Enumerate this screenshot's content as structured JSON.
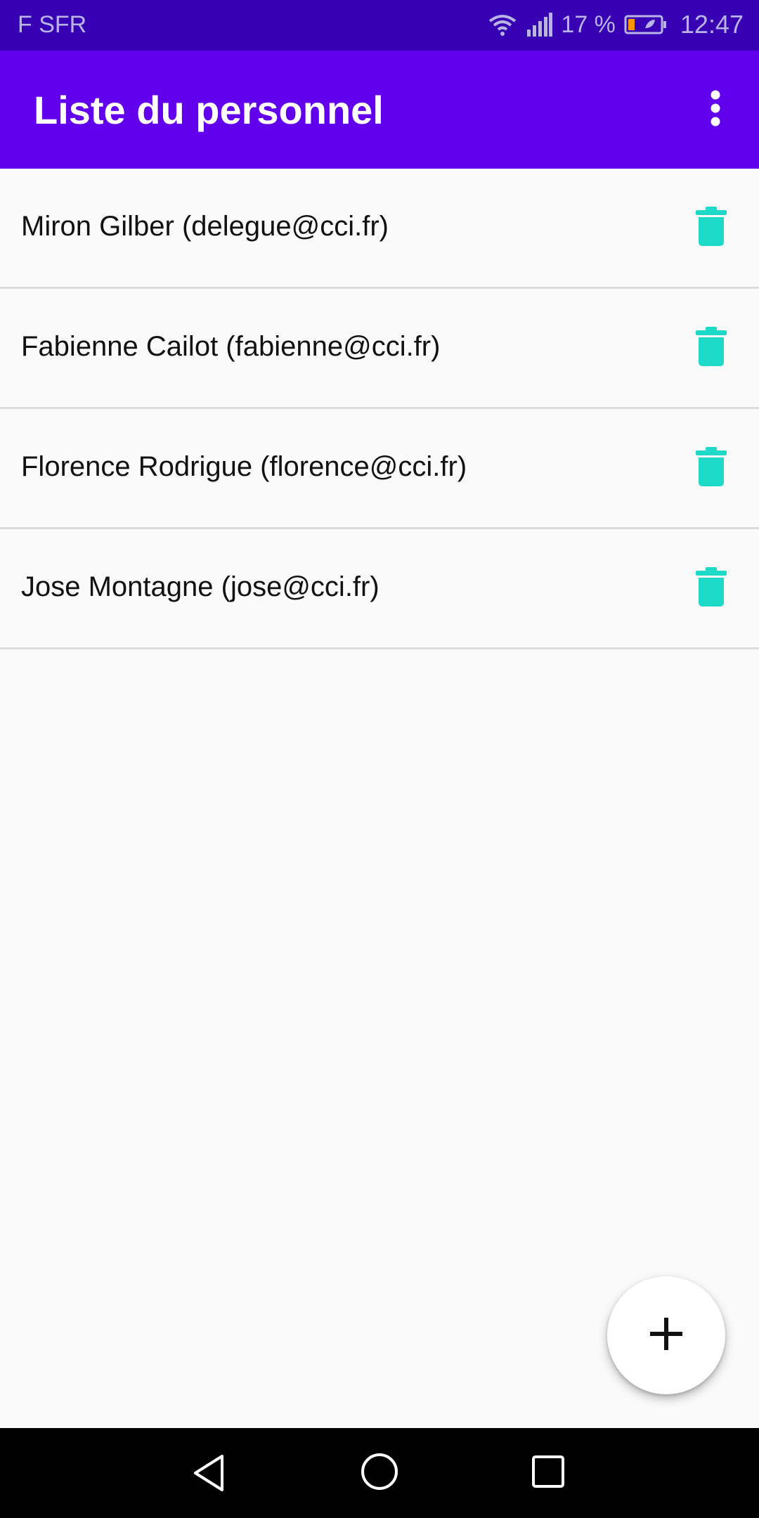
{
  "status_bar": {
    "carrier": "F SFR",
    "battery_percent": "17 %",
    "time": "12:47",
    "icons": [
      "wifi-icon",
      "signal-icon",
      "battery-icon"
    ]
  },
  "app_bar": {
    "title": "Liste du personnel",
    "overflow_icon": "more-vert-icon"
  },
  "staff_list": [
    {
      "label": "Miron Gilber (delegue@cci.fr)"
    },
    {
      "label": "Fabienne Cailot (fabienne@cci.fr)"
    },
    {
      "label": "Florence Rodrigue (florence@cci.fr)"
    },
    {
      "label": "Jose Montagne (jose@cci.fr)"
    }
  ],
  "fab": {
    "icon": "plus-icon"
  },
  "nav_bar": {
    "icons": [
      "back-icon",
      "home-icon",
      "recents-icon"
    ]
  },
  "colors": {
    "status_bar": "#3700b3",
    "app_bar": "#6200ee",
    "delete_icon": "#1dd9c8",
    "background": "#fafafa"
  }
}
